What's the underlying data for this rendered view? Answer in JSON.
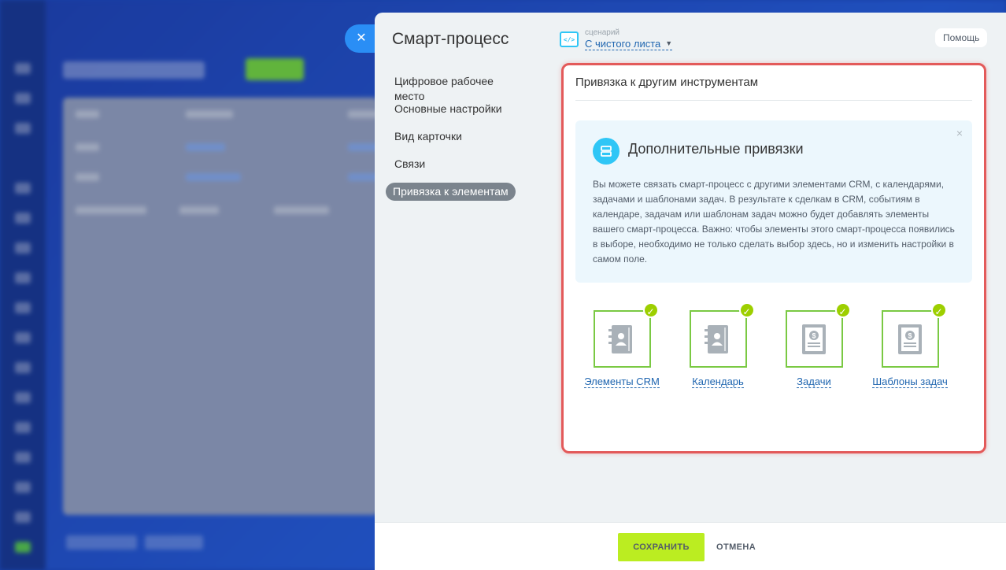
{
  "slider": {
    "title": "Смарт-процесс",
    "close_icon": "close-icon",
    "scenario": {
      "icon": "code-icon",
      "icon_glyph": "</>",
      "caption": "сценарий",
      "value": "С чистого листа",
      "chevron": "⌄"
    },
    "help_label": "Помощь"
  },
  "nav": {
    "items": [
      {
        "label": "Цифровое рабочее место"
      },
      {
        "label": "Основные настройки"
      },
      {
        "label": "Вид карточки"
      },
      {
        "label": "Связи"
      },
      {
        "label": "Привязка к элементам",
        "active": true
      }
    ]
  },
  "card": {
    "title": "Привязка к другим инструментам",
    "info": {
      "icon": "stack-icon",
      "close": "×",
      "title": "Дополнительные привязки",
      "text": "Вы можете связать смарт-процесс с другими элементами CRM, с календарями, задачами и шаблонами задач. В результате к сделкам в CRM, событиям в календаре, задачам или шаблонам задач можно будет добавлять элементы вашего смарт-процесса. Важно: чтобы элементы этого смарт-процесса появились в выборе, необходимо не только сделать выбор здесь, но и изменить настройки в самом поле."
    },
    "tools": [
      {
        "label": "Элементы CRM",
        "icon": "contact-book-icon",
        "checked": true
      },
      {
        "label": "Календарь",
        "icon": "contact-book-icon",
        "checked": true
      },
      {
        "label": "Задачи",
        "icon": "dollar-document-icon",
        "checked": true
      },
      {
        "label": "Шаблоны задач",
        "icon": "dollar-document-icon",
        "checked": true
      }
    ]
  },
  "footer": {
    "save_label": "СОХРАНИТЬ",
    "cancel_label": "ОТМЕНА"
  },
  "colors": {
    "accent": "#2fc6f6",
    "link": "#2066b0",
    "save": "#bbed21",
    "check": "#9dcf00",
    "highlight_border": "#e35a5a"
  }
}
